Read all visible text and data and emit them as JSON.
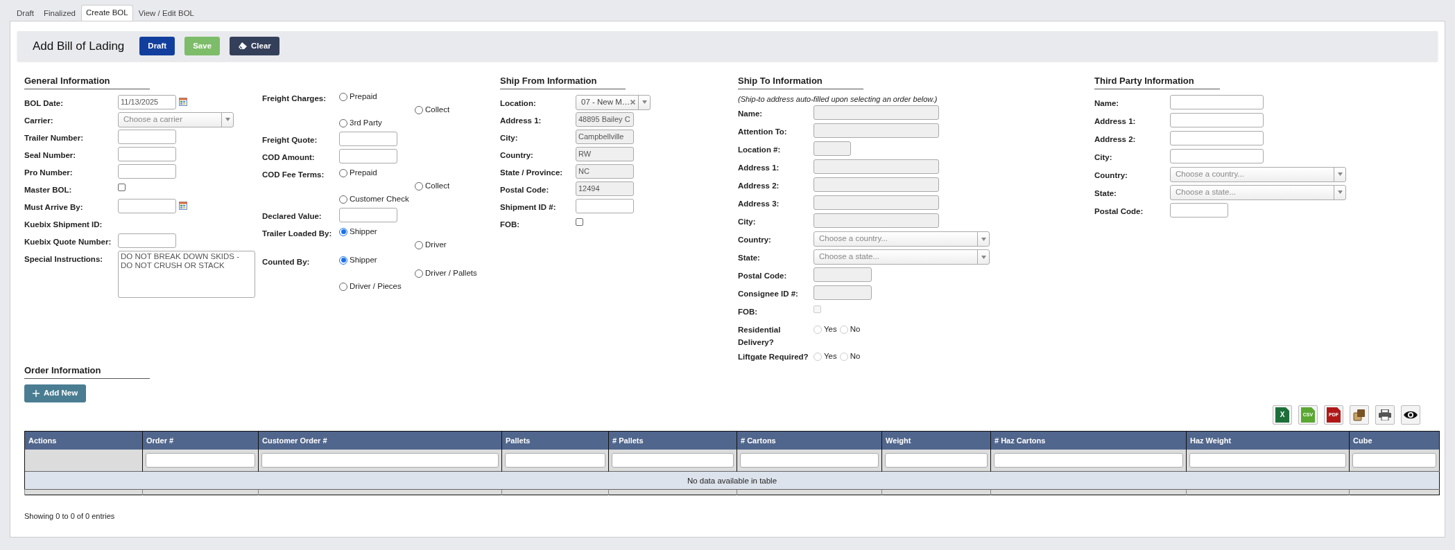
{
  "tabs": [
    {
      "label": "Draft",
      "selected": false
    },
    {
      "label": "Finalized",
      "selected": false
    },
    {
      "label": "Create BOL",
      "selected": true
    },
    {
      "label": "View / Edit BOL",
      "selected": false
    }
  ],
  "header": {
    "title": "Add Bill of Lading",
    "buttons": [
      {
        "label": "Draft",
        "kind": "primary"
      },
      {
        "label": "Save",
        "kind": "success"
      },
      {
        "label": "Clear",
        "kind": "clear"
      }
    ]
  },
  "general_information": {
    "heading": "General Information",
    "fields": [
      {
        "label": "BOL Date:",
        "kind": "date",
        "value": "11/13/2025"
      },
      {
        "label": "Carrier:",
        "kind": "select",
        "placeholder": "Choose a carrier"
      },
      {
        "label": "Trailer Number:",
        "kind": "text",
        "disabled": false
      },
      {
        "label": "Seal Number:",
        "kind": "text",
        "disabled": false
      },
      {
        "label": "Pro Number:",
        "kind": "text",
        "disabled": false
      },
      {
        "label": "Master BOL:",
        "kind": "checkbox",
        "checked": false,
        "disabled": false
      },
      {
        "label": "Must Arrive By:",
        "kind": "date"
      },
      {
        "label": "Kuebix Shipment ID:",
        "kind": "none"
      },
      {
        "label": "Kuebix Quote Number:",
        "kind": "text",
        "disabled": false
      },
      {
        "label": "Special Instructions:",
        "kind": "textarea",
        "value": "DO NOT BREAK DOWN SKIDS - DO NOT CRUSH OR STACK"
      }
    ]
  },
  "charges": {
    "fields": [
      {
        "label": "Freight Charges:",
        "kind": "radio",
        "options": [
          {
            "label": "Prepaid",
            "selected": false
          },
          {
            "label": "Collect",
            "selected": false
          },
          {
            "label": "3rd Party",
            "selected": false
          }
        ]
      },
      {
        "label": "Freight Quote:",
        "kind": "text",
        "disabled": false
      },
      {
        "label": "COD Amount:",
        "kind": "text",
        "disabled": false
      },
      {
        "label": "COD Fee Terms:",
        "kind": "radio",
        "options": [
          {
            "label": "Prepaid",
            "selected": false
          },
          {
            "label": "Collect",
            "selected": false
          },
          {
            "label": "Customer Check",
            "selected": false
          }
        ]
      },
      {
        "label": "Declared Value:",
        "kind": "text",
        "disabled": false
      },
      {
        "label": "Trailer Loaded By:",
        "kind": "radio",
        "options": [
          {
            "label": "Shipper",
            "selected": true
          },
          {
            "label": "Driver",
            "selected": false
          }
        ]
      },
      {
        "label": "Counted By:",
        "kind": "radio",
        "options": [
          {
            "label": "Shipper",
            "selected": true
          },
          {
            "label": "Driver / Pallets",
            "selected": false
          },
          {
            "label": "Driver / Pieces",
            "selected": false
          }
        ]
      }
    ]
  },
  "ship_from_information": {
    "heading": "Ship From Information",
    "fields": [
      {
        "label": "Location:",
        "kind": "short-select",
        "value": "07 - New M…",
        "clearable": true
      },
      {
        "label": "Address 1:",
        "kind": "text",
        "value": "48895 Bailey C",
        "disabled": true
      },
      {
        "label": "City:",
        "kind": "text",
        "value": "Campbellville",
        "disabled": true
      },
      {
        "label": "Country:",
        "kind": "text",
        "value": "RW",
        "disabled": true
      },
      {
        "label": "State / Province:",
        "kind": "text",
        "value": "NC",
        "disabled": true
      },
      {
        "label": "Postal Code:",
        "kind": "text",
        "value": "12494",
        "disabled": true
      },
      {
        "label": "Shipment ID #:",
        "kind": "text",
        "disabled": false
      },
      {
        "label": "FOB:",
        "kind": "checkbox",
        "checked": false,
        "disabled": false
      }
    ]
  },
  "ship_to_information": {
    "heading": "Ship To Information",
    "note": "(Ship-to address auto-filled upon selecting an order below.)",
    "fields": [
      {
        "label": "Name:",
        "kind": "wide-text",
        "disabled": true
      },
      {
        "label": "Attention To:",
        "kind": "wide-text",
        "disabled": true
      },
      {
        "label": "Location #:",
        "kind": "short-text",
        "disabled": true
      },
      {
        "label": "Address 1:",
        "kind": "wide-text",
        "disabled": true
      },
      {
        "label": "Address 2:",
        "kind": "wide-text",
        "disabled": true
      },
      {
        "label": "Address 3:",
        "kind": "wide-text",
        "disabled": true
      },
      {
        "label": "City:",
        "kind": "wide-text",
        "disabled": true
      },
      {
        "label": "Country:",
        "kind": "wide-select",
        "placeholder": "Choose a country..."
      },
      {
        "label": "State:",
        "kind": "wide-select",
        "placeholder": "Choose a state..."
      },
      {
        "label": "Postal Code:",
        "kind": "text",
        "disabled": true
      },
      {
        "label": "Consignee ID #:",
        "kind": "text",
        "disabled": true
      },
      {
        "label": "FOB:",
        "kind": "checkbox",
        "checked": false,
        "disabled": true
      },
      {
        "label": "Residential Delivery?",
        "kind": "yesno",
        "disabled": true,
        "options": [
          {
            "label": "Yes",
            "selected": false
          },
          {
            "label": "No",
            "selected": false
          }
        ]
      },
      {
        "label": "Liftgate Required?",
        "kind": "yesno",
        "disabled": true,
        "options": [
          {
            "label": "Yes",
            "selected": false
          },
          {
            "label": "No",
            "selected": false
          }
        ]
      }
    ]
  },
  "third_party_information": {
    "heading": "Third Party Information",
    "fields": [
      {
        "label": "Name:",
        "kind": "long-text",
        "disabled": false
      },
      {
        "label": "Address 1:",
        "kind": "long-text",
        "disabled": false
      },
      {
        "label": "Address 2:",
        "kind": "long-text",
        "disabled": false
      },
      {
        "label": "City:",
        "kind": "long-text",
        "disabled": false
      },
      {
        "label": "Country:",
        "kind": "wide-select",
        "placeholder": "Choose a country..."
      },
      {
        "label": "State:",
        "kind": "wide-select",
        "placeholder": "Choose a state..."
      },
      {
        "label": "Postal Code:",
        "kind": "text",
        "disabled": false
      }
    ]
  },
  "order_information": {
    "heading": "Order Information",
    "add_button": "Add New",
    "export_buttons": [
      {
        "kind": "excel",
        "label": "X"
      },
      {
        "kind": "csv",
        "label": "CSV"
      },
      {
        "kind": "pdf",
        "label": "PDF"
      },
      {
        "kind": "copy"
      },
      {
        "kind": "print"
      },
      {
        "kind": "view"
      }
    ],
    "table": {
      "columns": [
        {
          "label": "Actions",
          "filter": false
        },
        {
          "label": "Order #",
          "filter": true
        },
        {
          "label": "Customer Order #",
          "filter": true
        },
        {
          "label": "Pallets",
          "filter": true
        },
        {
          "label": "# Pallets",
          "filter": true
        },
        {
          "label": "# Cartons",
          "filter": true
        },
        {
          "label": "Weight",
          "filter": true
        },
        {
          "label": "# Haz Cartons",
          "filter": true
        },
        {
          "label": "Haz Weight",
          "filter": true
        },
        {
          "label": "Cube",
          "filter": true
        }
      ],
      "empty_message": "No data available in table"
    },
    "info": "Showing 0 to 0 of 0 entries"
  }
}
